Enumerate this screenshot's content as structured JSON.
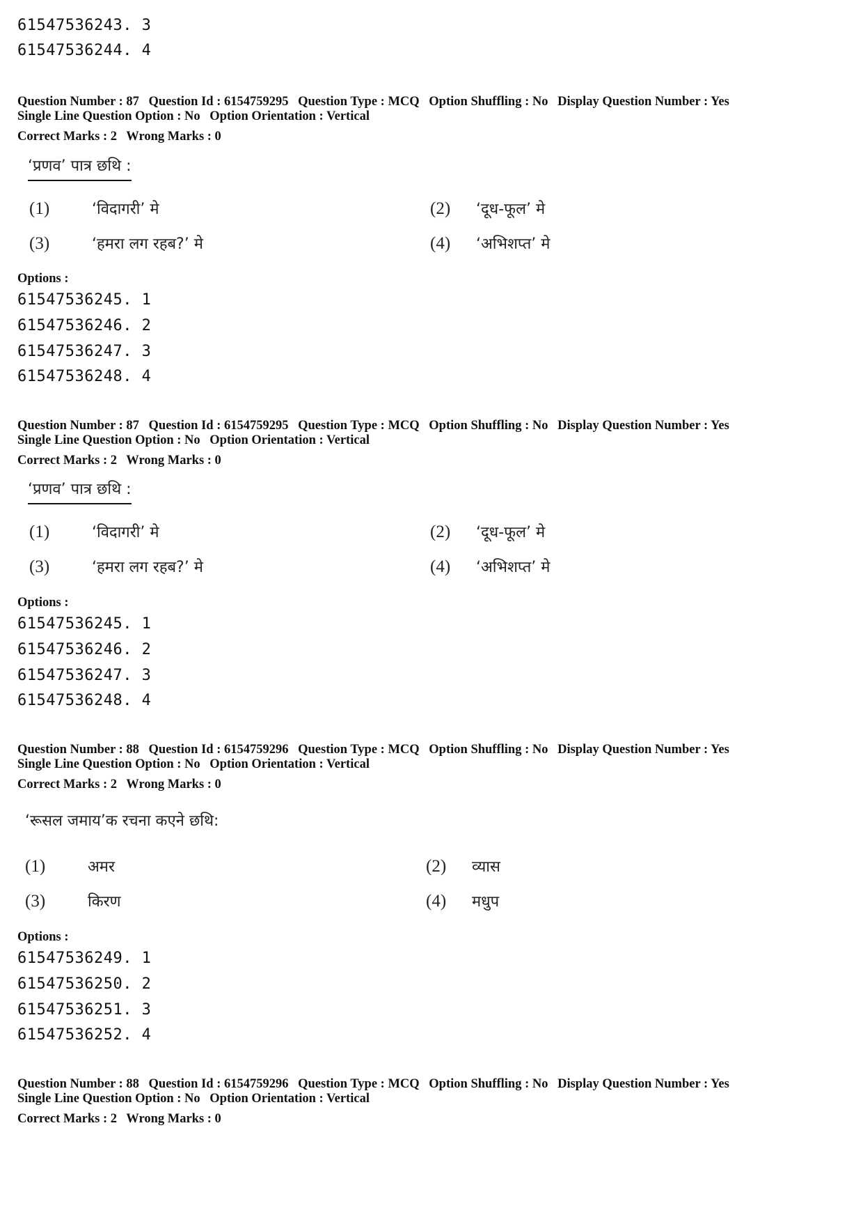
{
  "prev_options": [
    "61547536243. 3",
    "61547536244. 4"
  ],
  "questions": [
    {
      "meta": {
        "number": "Question Number : 87",
        "id": "Question Id : 6154759295",
        "type": "Question Type : MCQ",
        "shuffling": "Option Shuffling : No",
        "display": "Display Question Number : Yes",
        "single_line": "Single Line Question Option : No",
        "orientation": "Option Orientation : Vertical",
        "correct": "Correct Marks : 2",
        "wrong": "Wrong Marks : 0"
      },
      "stem": "‘प्रणव’ पात्र छथि :",
      "choices": [
        {
          "num": "(1)",
          "text": "‘विदागरी’ मे"
        },
        {
          "num": "(2)",
          "text": "‘दूध-फूल’ मे"
        },
        {
          "num": "(3)",
          "text": "‘हमरा लग रहब?’ मे"
        },
        {
          "num": "(4)",
          "text": "‘अभिशप्त’ मे"
        }
      ],
      "options_label": "Options :",
      "options": [
        "61547536245. 1",
        "61547536246. 2",
        "61547536247. 3",
        "61547536248. 4"
      ]
    },
    {
      "meta": {
        "number": "Question Number : 87",
        "id": "Question Id : 6154759295",
        "type": "Question Type : MCQ",
        "shuffling": "Option Shuffling : No",
        "display": "Display Question Number : Yes",
        "single_line": "Single Line Question Option : No",
        "orientation": "Option Orientation : Vertical",
        "correct": "Correct Marks : 2",
        "wrong": "Wrong Marks : 0"
      },
      "stem": "‘प्रणव’ पात्र छथि :",
      "choices": [
        {
          "num": "(1)",
          "text": "‘विदागरी’ मे"
        },
        {
          "num": "(2)",
          "text": "‘दूध-फूल’ मे"
        },
        {
          "num": "(3)",
          "text": "‘हमरा लग रहब?’ मे"
        },
        {
          "num": "(4)",
          "text": "‘अभिशप्त’ मे"
        }
      ],
      "options_label": "Options :",
      "options": [
        "61547536245. 1",
        "61547536246. 2",
        "61547536247. 3",
        "61547536248. 4"
      ]
    },
    {
      "meta": {
        "number": "Question Number : 88",
        "id": "Question Id : 6154759296",
        "type": "Question Type : MCQ",
        "shuffling": "Option Shuffling : No",
        "display": "Display Question Number : Yes",
        "single_line": "Single Line Question Option : No",
        "orientation": "Option Orientation : Vertical",
        "correct": "Correct Marks : 2",
        "wrong": "Wrong Marks : 0"
      },
      "stem": "‘रूसल जमाय’क रचना कएने छथि:",
      "choices": [
        {
          "num": "(1)",
          "text": "अमर"
        },
        {
          "num": "(2)",
          "text": "व्यास"
        },
        {
          "num": "(3)",
          "text": "किरण"
        },
        {
          "num": "(4)",
          "text": "मधुप"
        }
      ],
      "options_label": "Options :",
      "options": [
        "61547536249. 1",
        "61547536250. 2",
        "61547536251. 3",
        "61547536252. 4"
      ]
    },
    {
      "meta": {
        "number": "Question Number : 88",
        "id": "Question Id : 6154759296",
        "type": "Question Type : MCQ",
        "shuffling": "Option Shuffling : No",
        "display": "Display Question Number : Yes",
        "single_line": "Single Line Question Option : No",
        "orientation": "Option Orientation : Vertical",
        "correct": "Correct Marks : 2",
        "wrong": "Wrong Marks : 0"
      }
    }
  ]
}
